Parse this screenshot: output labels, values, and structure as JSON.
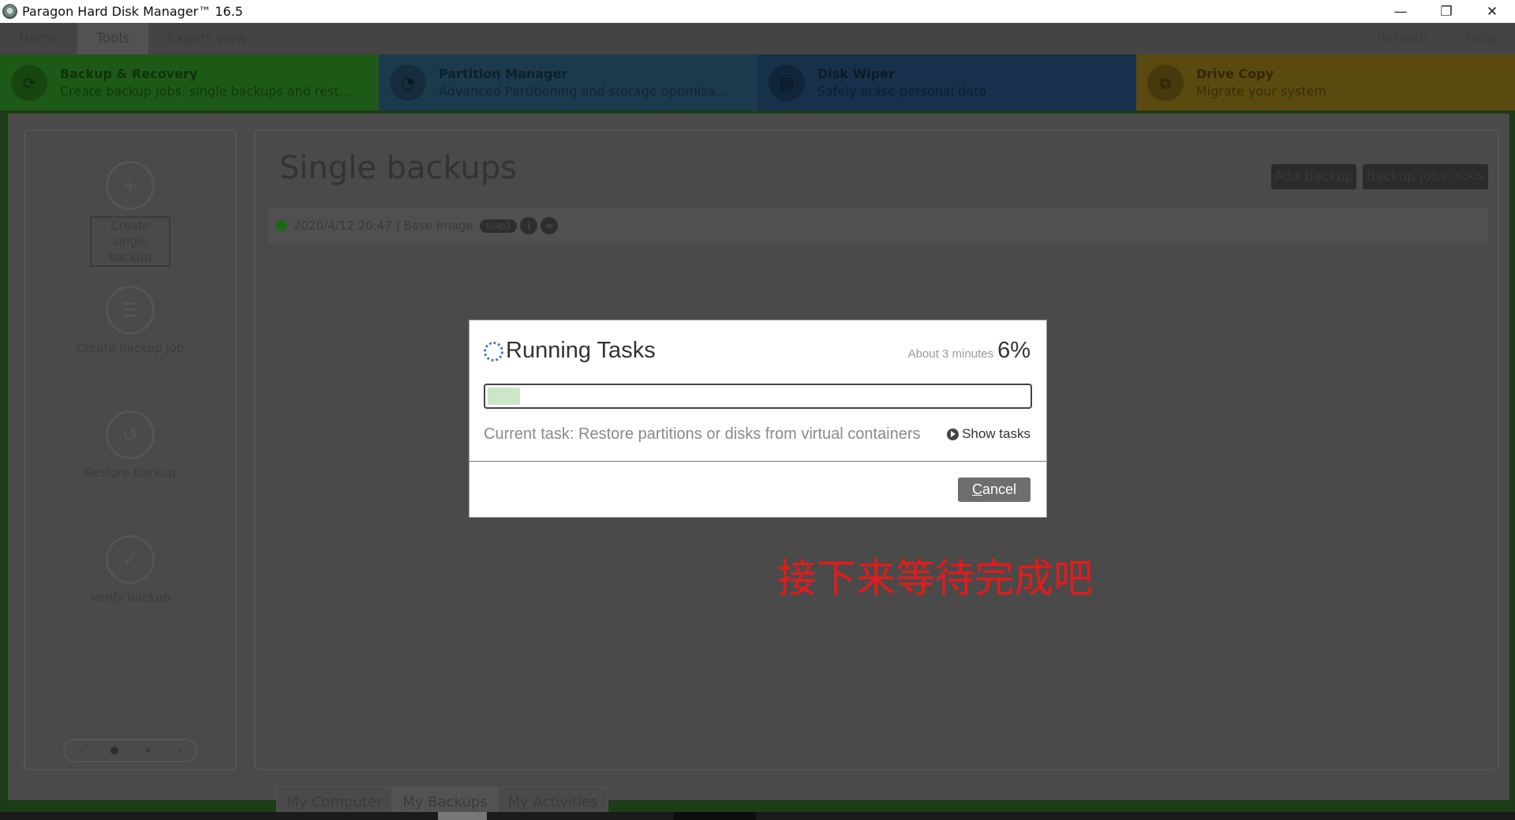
{
  "window": {
    "title": "Paragon Hard Disk Manager™ 16.5",
    "controls": {
      "minimize": "—",
      "restore": "❐",
      "close": "✕"
    }
  },
  "menubar": {
    "items": [
      "Home",
      "Tools",
      "Expert view"
    ],
    "right_items": [
      "Refresh",
      "Help"
    ],
    "active": "Tools"
  },
  "tiles": [
    {
      "title": "Backup & Recovery",
      "subtitle": "Create backup jobs, single backups and rest…",
      "color": "#1e5a17",
      "icon": "backup-icon"
    },
    {
      "title": "Partition Manager",
      "subtitle": "Advanced Partitioning and storage optimiza…",
      "color": "#1c3a4e",
      "icon": "partition-icon"
    },
    {
      "title": "Disk Wiper",
      "subtitle": "Safely erase personal data",
      "color": "#17304b",
      "icon": "wiper-icon"
    },
    {
      "title": "Drive Copy",
      "subtitle": "Migrate your system",
      "color": "#5a4a10",
      "icon": "copy-icon"
    }
  ],
  "left_actions": [
    {
      "label": "Create single backup",
      "icon": "create-backup-icon"
    },
    {
      "label": "Create backup job",
      "icon": "backup-job-icon"
    },
    {
      "label": "Restore backup",
      "icon": "restore-icon"
    },
    {
      "label": "Verify backup",
      "icon": "verify-icon"
    }
  ],
  "pager": {
    "prev": "‹",
    "next": "›"
  },
  "main": {
    "title": "Single backups",
    "buttons": {
      "add_backup": "Add Backup",
      "backup_jobs": "Backup jobs >>>"
    },
    "backup_row": {
      "text": "2020/4/12 20:47 | Base Image",
      "badge": "used"
    }
  },
  "bottom_tabs": [
    "My Computer",
    "My Backups",
    "My Activities"
  ],
  "dialog": {
    "title": "Running Tasks",
    "eta": "About 3 minutes",
    "percent_label": "6%",
    "progress": 0.06,
    "current_task": "Current task: Restore partitions or disks from virtual containers",
    "show_tasks": "Show tasks",
    "cancel_first": "C",
    "cancel_rest": "ancel"
  },
  "annotation": {
    "text": "接下来等待完成吧",
    "color": "#e21b1b"
  }
}
